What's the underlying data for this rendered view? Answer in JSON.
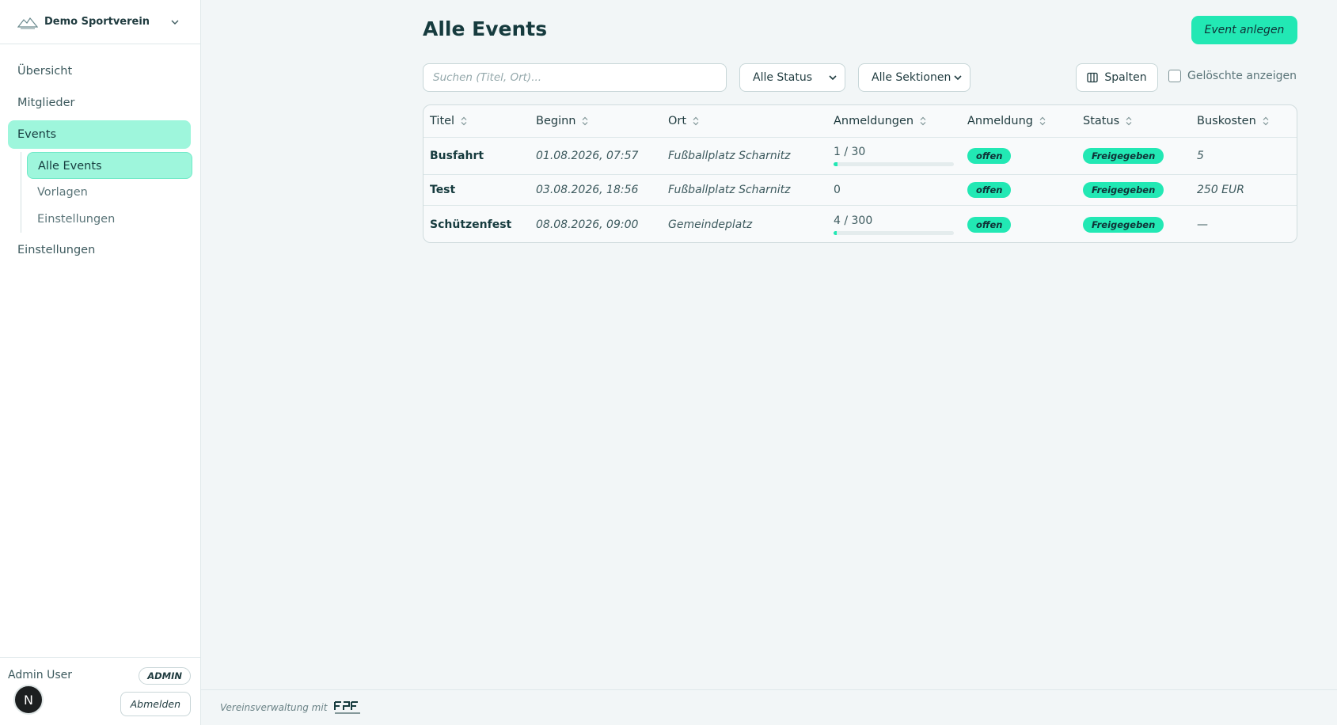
{
  "sidebar": {
    "club_name": "Demo Sportverein",
    "nav": {
      "overview": "Übersicht",
      "members": "Mitglieder",
      "events": "Events",
      "events_sub": {
        "all": "Alle Events",
        "templates": "Vorlagen",
        "settings": "Einstellungen"
      },
      "settings": "Einstellungen"
    },
    "user": {
      "name": "Admin User",
      "role": "ADMIN",
      "avatar_initial": "N",
      "logout": "Abmelden"
    }
  },
  "main": {
    "title": "Alle Events",
    "create_button": "Event anlegen",
    "search_placeholder": "Suchen (Titel, Ort)...",
    "status_filter": "Alle Status",
    "section_filter": "Alle Sektionen",
    "columns_button": "Spalten",
    "show_deleted": "Gelöschte anzeigen"
  },
  "table": {
    "headers": [
      "Titel",
      "Beginn",
      "Ort",
      "Anmeldungen",
      "Anmeldung",
      "Status",
      "Buskosten"
    ],
    "rows": [
      {
        "title": "Busfahrt",
        "start": "01.08.2026, 07:57",
        "location": "Fußballplatz Scharnitz",
        "registrations": "1 / 30",
        "reg_fraction": 0.0333,
        "registration": "offen",
        "status": "Freigegeben",
        "bus_cost": "5"
      },
      {
        "title": "Test",
        "start": "03.08.2026, 18:56",
        "location": "Fußballplatz Scharnitz",
        "registrations": "0",
        "registration": "offen",
        "status": "Freigegeben",
        "bus_cost": "250 EUR"
      },
      {
        "title": "Schützenfest",
        "start": "08.08.2026, 09:00",
        "location": "Gemeindeplatz",
        "registrations": "4 / 300",
        "reg_fraction": 0.0133,
        "registration": "offen",
        "status": "Freigegeben",
        "bus_cost": "—"
      }
    ]
  },
  "footer": {
    "text": "Vereinsverwaltung mit",
    "brand": "flow2finance"
  },
  "colors": {
    "accent": "#22e8b4",
    "accent_light": "#9ef6dc",
    "text_dark": "#163b3e"
  }
}
